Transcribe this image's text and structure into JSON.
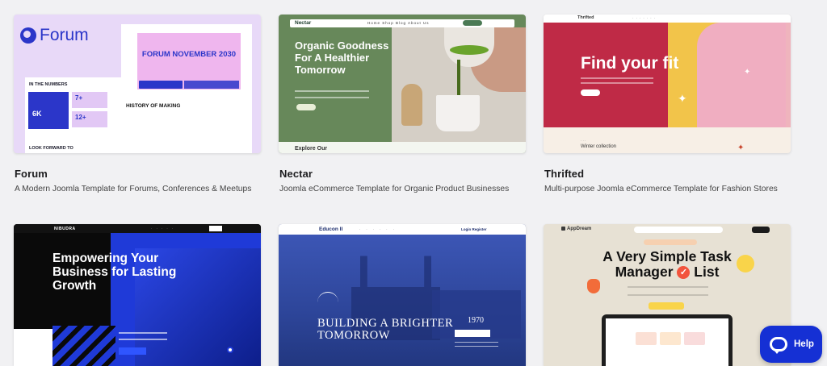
{
  "cards": [
    {
      "title": "Forum",
      "description": "A Modern Joomla Template for Forums, Conferences & Meetups",
      "preview": {
        "logo": "Forum",
        "hero_title": "FORUM NOVEMBER 2030",
        "numbers_heading": "IN THE NUMBERS",
        "stat_main": "6K",
        "stat_a": "7+",
        "stat_b": "12+",
        "history": "HISTORY OF MAKING",
        "look": "LOOK FORWARD TO"
      }
    },
    {
      "title": "Nectar",
      "description": "Joomla eCommerce Template for Organic Product Businesses",
      "preview": {
        "brand": "Nectar",
        "nav": "Home  Shop  Blog  About Us",
        "headline": "Organic Goodness For A Healthier Tomorrow",
        "footer": "Explore Our"
      }
    },
    {
      "title": "Thrifted",
      "description": "Multi-purpose Joomla eCommerce Template for Fashion Stores",
      "preview": {
        "brand": "Thrifted",
        "headline": "Find your fit",
        "section": "Winter collection"
      }
    },
    {
      "title": "",
      "description": "",
      "preview": {
        "brand": "NIBUDRA",
        "headline": "Empowering Your Business for Lasting Growth"
      }
    },
    {
      "title": "",
      "description": "",
      "preview": {
        "brand": "Educon II",
        "nav_right": "Login  Register",
        "headline": "BUILDING A BRIGHTER TOMORROW",
        "year": "1970"
      }
    },
    {
      "title": "",
      "description": "",
      "preview": {
        "brand": "AppDream",
        "headline_a": "A Very Simple Task",
        "headline_b": "Manager",
        "headline_c": "List"
      }
    }
  ],
  "help": {
    "label": "Help",
    "icon": "chat-bubble-icon"
  },
  "colors": {
    "forum_accent": "#2b36c9",
    "nectar_green": "#67885a",
    "thrifted_red": "#bf2a46",
    "business_blue": "#1f3ad8",
    "education_blue": "#2a3f91",
    "help_button": "#1530d4"
  }
}
